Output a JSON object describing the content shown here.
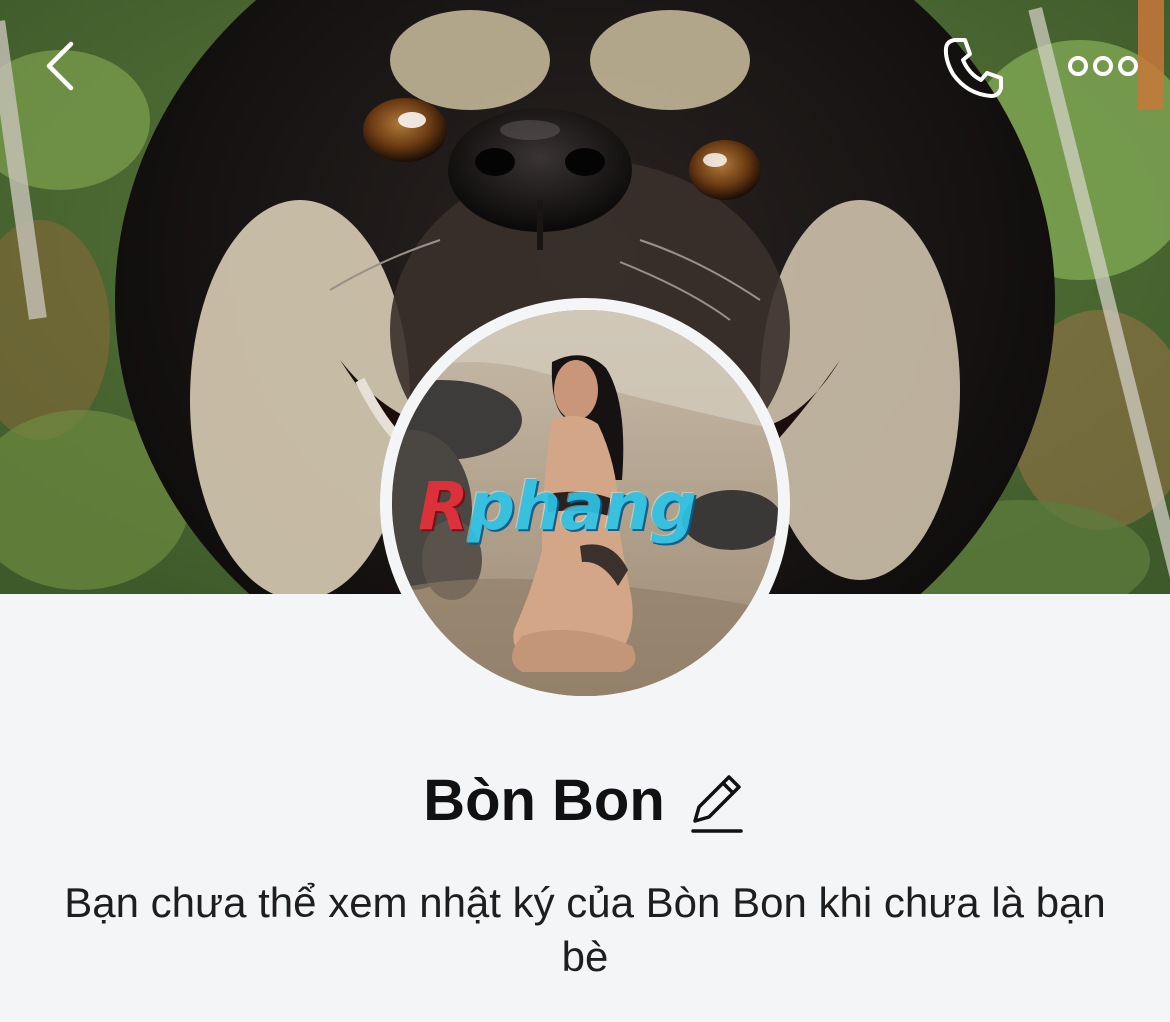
{
  "header": {
    "back_icon": "chevron-left-icon",
    "call_icon": "phone-icon",
    "more_icon": "more-dots-icon"
  },
  "profile": {
    "name": "Bòn Bon",
    "edit_icon": "pencil-icon",
    "avatar_watermark": "Rphang",
    "notice": "Bạn chưa thể xem nhật ký của Bòn Bon khi chưa là bạn bè"
  },
  "colors": {
    "background": "#f4f5f7",
    "text_primary": "#111111",
    "icon_white": "#ffffff"
  }
}
